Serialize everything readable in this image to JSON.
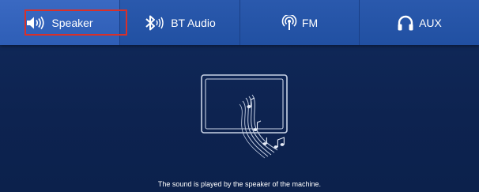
{
  "tabs": [
    {
      "label": "Speaker",
      "icon": "speaker-icon",
      "active": true
    },
    {
      "label": "BT Audio",
      "icon": "bluetooth-icon",
      "active": false
    },
    {
      "label": "FM",
      "icon": "radio-antenna-icon",
      "active": false
    },
    {
      "label": "AUX",
      "icon": "headphones-icon",
      "active": false
    }
  ],
  "main": {
    "illustration": "screen-with-music-notes-icon",
    "caption": "The sound is played by the speaker of the machine."
  },
  "colors": {
    "background": "#0f2450",
    "tabbar": "#2453a6",
    "active_highlight": "#d8302a",
    "text": "#ffffff"
  }
}
